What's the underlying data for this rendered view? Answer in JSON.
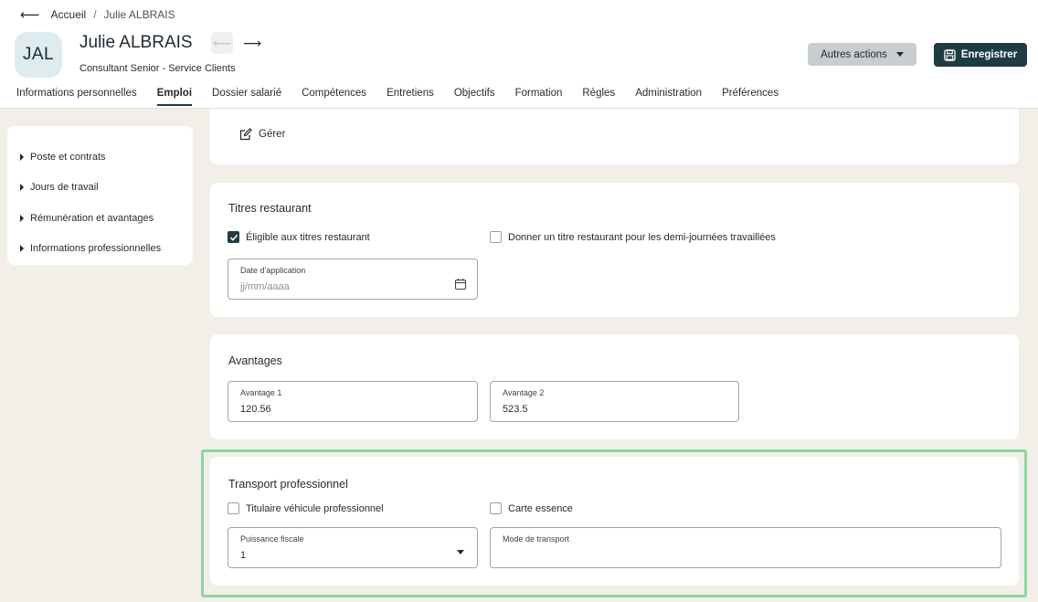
{
  "breadcrumb": {
    "home": "Accueil",
    "separator": "/",
    "current": "Julie ALBRAIS"
  },
  "profile": {
    "initials": "JAL",
    "name": "Julie ALBRAIS",
    "subtitle": "Consultant Senior - Service Clients"
  },
  "actions": {
    "more_label": "Autres actions",
    "save_label": "Enregistrer"
  },
  "tabs": [
    {
      "label": "Informations personnelles",
      "active": false
    },
    {
      "label": "Emploi",
      "active": true
    },
    {
      "label": "Dossier salarié",
      "active": false
    },
    {
      "label": "Compétences",
      "active": false
    },
    {
      "label": "Entretiens",
      "active": false
    },
    {
      "label": "Objectifs",
      "active": false
    },
    {
      "label": "Formation",
      "active": false
    },
    {
      "label": "Règles",
      "active": false
    },
    {
      "label": "Administration",
      "active": false
    },
    {
      "label": "Préférences",
      "active": false
    }
  ],
  "sidebar": {
    "items": [
      {
        "label": "Poste et contrats"
      },
      {
        "label": "Jours de travail"
      },
      {
        "label": "Rémunération et avantages"
      },
      {
        "label": "Informations professionnelles"
      }
    ]
  },
  "manage_card": {
    "manage_label": "Gérer"
  },
  "meal_vouchers": {
    "title": "Titres restaurant",
    "eligible_label": "Éligible aux titres restaurant",
    "eligible_checked": true,
    "half_day_label": "Donner un titre restaurant pour les demi-journées travaillées",
    "half_day_checked": false,
    "date_label": "Date d'application",
    "date_placeholder": "jj/mm/aaaa"
  },
  "benefits": {
    "title": "Avantages",
    "field1_label": "Avantage 1",
    "field1_value": "120.56",
    "field2_label": "Avantage 2",
    "field2_value": "523.5"
  },
  "transport": {
    "title": "Transport professionnel",
    "vehicle_label": "Titulaire véhicule professionnel",
    "vehicle_checked": false,
    "fuel_card_label": "Carte essence",
    "fuel_card_checked": false,
    "power_label": "Puissance fiscale",
    "power_value": "1",
    "mode_label": "Mode de transport",
    "mode_value": ""
  },
  "colors": {
    "primary": "#1f3c45",
    "background": "#f2efe8",
    "highlight": "#8fd6a0"
  }
}
